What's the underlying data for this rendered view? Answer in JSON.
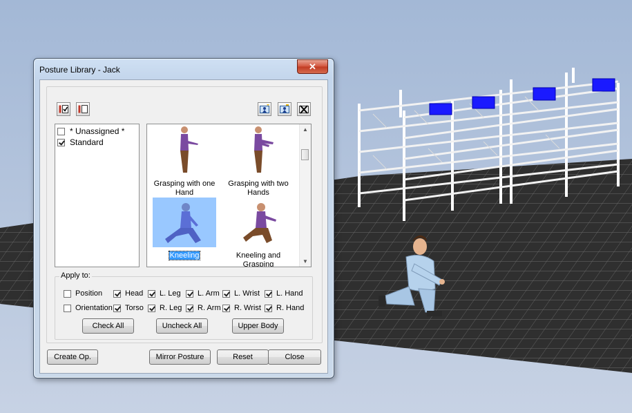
{
  "window": {
    "title": "Posture Library - Jack",
    "close_glyph": "✕"
  },
  "toolbar": {
    "left_icons": [
      "check-all-list-icon",
      "uncheck-all-list-icon"
    ],
    "right_icons": [
      "add-posture-icon",
      "edit-posture-icon",
      "delete-posture-icon"
    ]
  },
  "categories": [
    {
      "label": "* Unassigned *",
      "checked": false
    },
    {
      "label": "Standard",
      "checked": true
    }
  ],
  "postures": [
    {
      "label": "Grasping with one Hand",
      "selected": false
    },
    {
      "label": "Grasping with two Hands",
      "selected": false
    },
    {
      "label": "Kneeling",
      "selected": true
    },
    {
      "label": "Kneeling and Grasping",
      "selected": false
    }
  ],
  "apply": {
    "legend": "Apply to:",
    "row1": [
      {
        "label": "Position",
        "checked": false
      },
      {
        "label": "Head",
        "checked": true
      },
      {
        "label": "L. Leg",
        "checked": true
      },
      {
        "label": "L. Arm",
        "checked": true
      },
      {
        "label": "L. Wrist",
        "checked": true
      },
      {
        "label": "L. Hand",
        "checked": true
      }
    ],
    "row2": [
      {
        "label": "Orientation",
        "checked": false
      },
      {
        "label": "Torso",
        "checked": true
      },
      {
        "label": "R. Leg",
        "checked": true
      },
      {
        "label": "R. Arm",
        "checked": true
      },
      {
        "label": "R. Wrist",
        "checked": true
      },
      {
        "label": "R. Hand",
        "checked": true
      }
    ],
    "check_all": "Check All",
    "uncheck_all": "Uncheck All",
    "upper_body": "Upper Body"
  },
  "footer": {
    "create_op": "Create Op.",
    "mirror": "Mirror Posture",
    "reset": "Reset",
    "close": "Close"
  },
  "colors": {
    "sky_top": "#9fb6d4",
    "floor": "#2b2b2b",
    "rack": "#ffffff",
    "box": "#1a1aff",
    "selection": "#3399ff"
  }
}
